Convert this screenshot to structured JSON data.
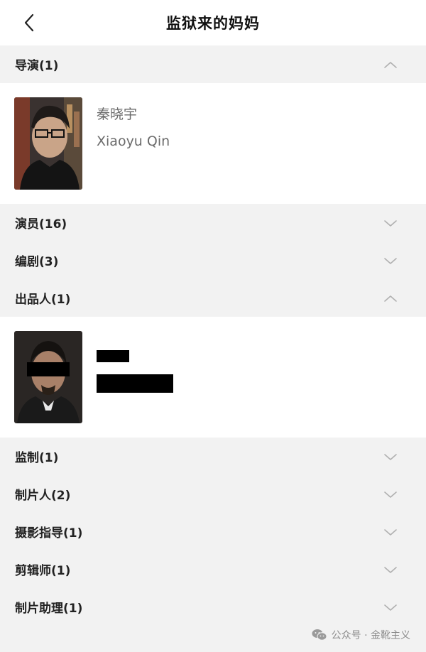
{
  "header": {
    "title": "监狱来的妈妈",
    "back_icon": "chevron-left-icon"
  },
  "sections": {
    "director": {
      "label": "导演(1)",
      "state": "expanded"
    },
    "cast": {
      "label": "演员(16)",
      "state": "collapsed"
    },
    "screenwriter": {
      "label": "编剧(3)",
      "state": "collapsed"
    },
    "producer": {
      "label": "出品人(1)",
      "state": "expanded"
    },
    "supervisor": {
      "label": "监制(1)",
      "state": "collapsed"
    },
    "producer2": {
      "label": "制片人(2)",
      "state": "collapsed"
    },
    "cinematography": {
      "label": "摄影指导(1)",
      "state": "collapsed"
    },
    "editor": {
      "label": "剪辑师(1)",
      "state": "collapsed"
    },
    "production_assistant": {
      "label": "制片助理(1)",
      "state": "collapsed"
    }
  },
  "director_card": {
    "name_cn": "秦晓宇",
    "name_en": "Xiaoyu Qin"
  },
  "watermark": {
    "text": "公众号 · 金靴主义",
    "icon": "wechat-icon"
  },
  "colors": {
    "background": "#f2f2f2",
    "panel": "#ffffff",
    "chevron": "#b0b0b0",
    "redaction": "#000000"
  }
}
